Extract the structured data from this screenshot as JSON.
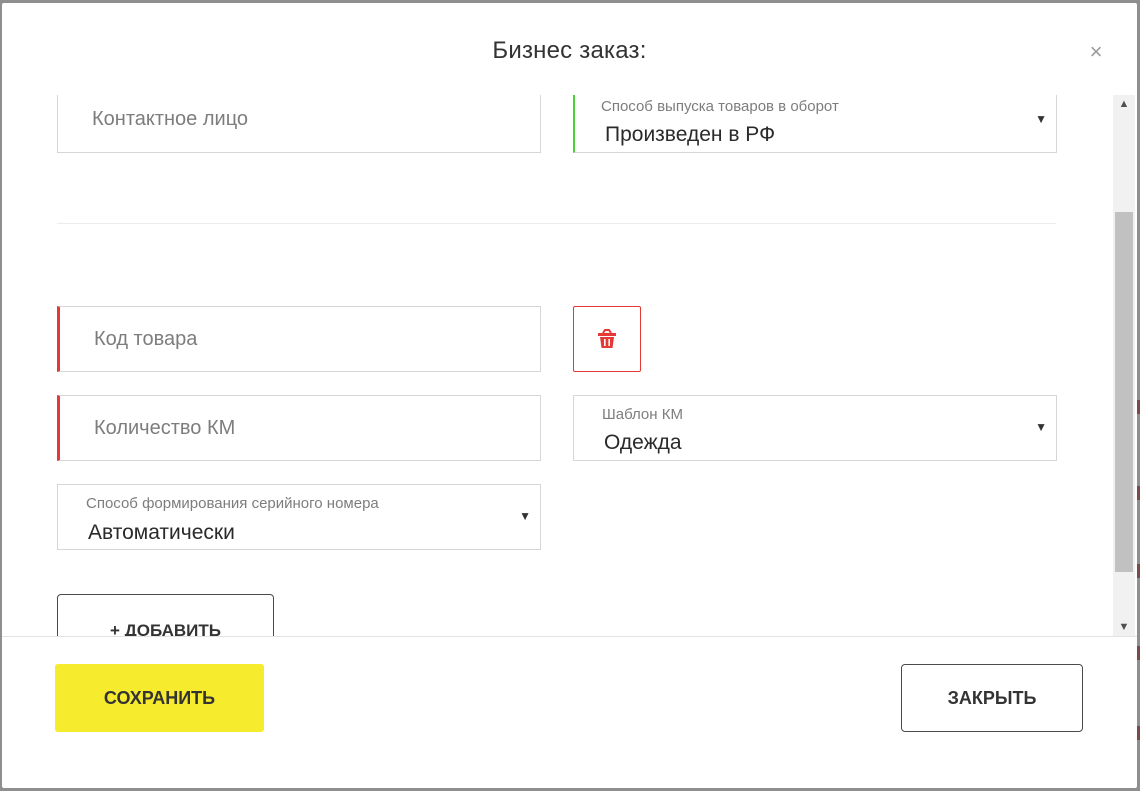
{
  "modal": {
    "title": "Бизнес заказ:",
    "close_glyph": "×"
  },
  "form": {
    "contact_person": {
      "placeholder": "Контактное лицо",
      "value": ""
    },
    "release_method": {
      "label": "Способ выпуска товаров в оборот",
      "value": "Произведен в РФ"
    },
    "product_code": {
      "placeholder": "Код товара",
      "value": ""
    },
    "km_quantity": {
      "placeholder": "Количество КМ",
      "value": ""
    },
    "km_template": {
      "label": "Шаблон КМ",
      "value": "Одежда"
    },
    "serial_method": {
      "label": "Способ формирования серийного номера",
      "value": "Автоматически"
    },
    "add_button": "+ ДОБАВИТЬ"
  },
  "footer": {
    "save_label": "СОХРАНИТЬ",
    "close_label": "ЗАКРЫТЬ"
  },
  "icons": {
    "delete": "trash-icon",
    "dropdown": "caret-down-icon",
    "close": "close-icon"
  },
  "colors": {
    "accent_yellow": "#f7eb2d",
    "error_red": "#e53935",
    "valid_green": "#4cd137"
  }
}
